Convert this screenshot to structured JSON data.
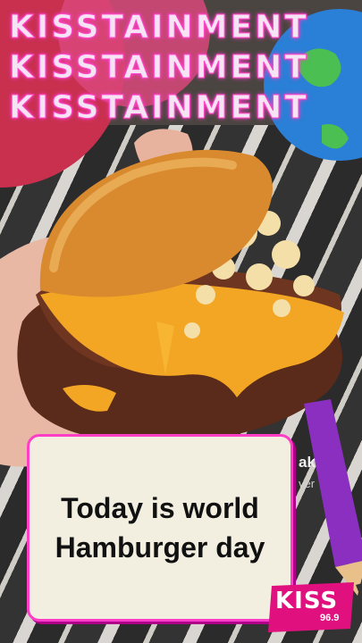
{
  "header": {
    "lines": [
      "KISSTAINMENT",
      "KISSTAINMENT",
      "KISSTAINMENT"
    ]
  },
  "caption": {
    "text": "Today is world Hamburger day"
  },
  "logo": {
    "name": "KISS",
    "frequency": "96.9"
  },
  "background_text": {
    "line1": "ak",
    "line2": "ver"
  },
  "colors": {
    "accent": "#ff3ec8",
    "card_bg": "#f2efe0"
  }
}
